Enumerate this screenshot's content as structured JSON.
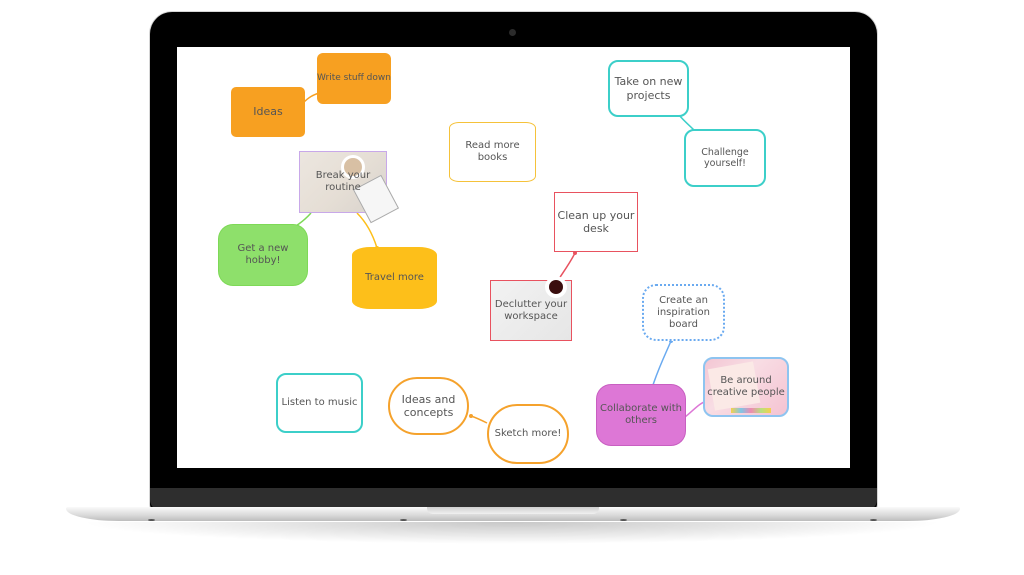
{
  "device": "laptop",
  "mindmap": {
    "nodes": {
      "ideas": {
        "label": "Ideas",
        "color": "#f7a021"
      },
      "write_stuff_down": {
        "label": "Write stuff down",
        "color": "#f7a021"
      },
      "break_your_routine": {
        "label": "Break your routine",
        "border": "#c8a8e9"
      },
      "get_a_new_hobby": {
        "label": "Get a new hobby!",
        "color": "#8ee06b"
      },
      "travel_more": {
        "label": "Travel more",
        "color": "#fdbf1a"
      },
      "read_more_books": {
        "label": "Read more books",
        "border": "#f5c23a"
      },
      "clean_up_your_desk": {
        "label": "Clean up your desk",
        "border": "#e8525f"
      },
      "declutter_your_workspace": {
        "label": "Declutter your workspace",
        "border": "#e8525f"
      },
      "take_on_new_projects": {
        "label": "Take on new projects",
        "border": "#3ccfc9"
      },
      "challenge_yourself": {
        "label": "Challenge yourself!",
        "border": "#3ccfc9"
      },
      "create_an_inspiration_board": {
        "label": "Create an inspiration board",
        "border": "#6aaaf0"
      },
      "be_around_creative_people": {
        "label": "Be around creative people",
        "border": "#8ec4f0"
      },
      "collaborate_with_others": {
        "label": "Collaborate with others",
        "color": "#dd77d6"
      },
      "listen_to_music": {
        "label": "Listen to music",
        "border": "#3ccfc9"
      },
      "ideas_and_concepts": {
        "label": "Ideas and concepts",
        "border": "#f5a22c"
      },
      "sketch_more": {
        "label": "Sketch more!",
        "border": "#f5a22c"
      }
    }
  }
}
